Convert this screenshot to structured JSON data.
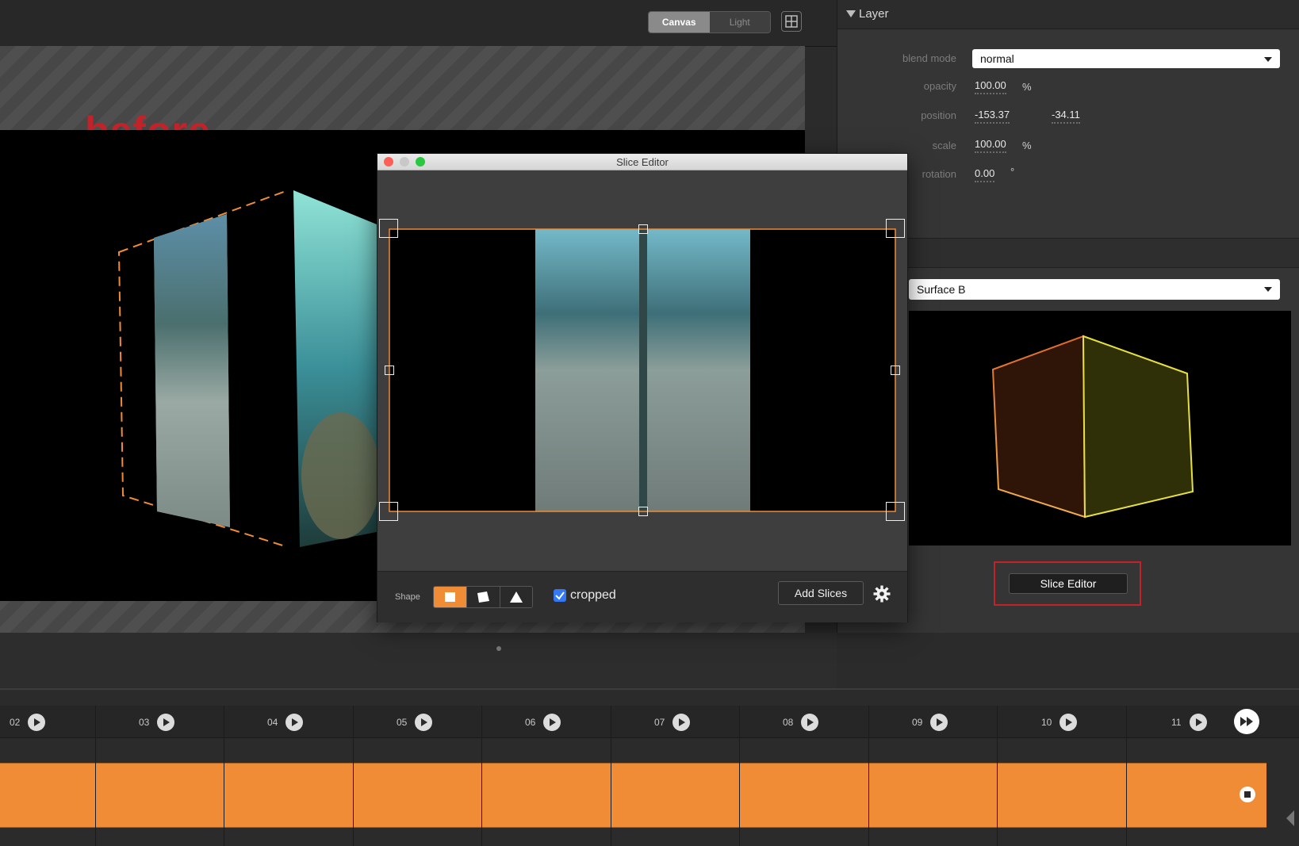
{
  "toolbar": {
    "view_tabs": [
      {
        "label": "Canvas",
        "active": true
      },
      {
        "label": "Light",
        "active": false
      }
    ],
    "grid_icon": "grid-icon"
  },
  "canvas": {
    "overlay_text": "before",
    "overlay_color": "#c22228"
  },
  "slice_editor": {
    "title": "Slice Editor",
    "shape_label": "Shape",
    "shapes": [
      "rectangle-shape-icon",
      "quad-shape-icon",
      "triangle-shape-icon"
    ],
    "selected_shape": "rectangle-shape-icon",
    "cropped_label": "cropped",
    "cropped_checked": true,
    "add_slices_label": "Add Slices",
    "settings_icon": "gear-icon"
  },
  "layer_panel": {
    "title": "Layer",
    "props": {
      "blend_mode_label": "blend mode",
      "blend_mode_value": "normal",
      "opacity_label": "opacity",
      "opacity_value": "100.00",
      "opacity_unit": "%",
      "position_label": "position",
      "position_x": "-153.37",
      "position_y": "-34.11",
      "scale_label": "scale",
      "scale_value": "100.00",
      "scale_unit": "%",
      "rotation_label": "rotation",
      "rotation_value": "0.00",
      "rotation_unit": "°"
    },
    "surface_value": "Surface B",
    "slice_editor_button": "Slice Editor"
  },
  "timeline": {
    "markers": [
      "02",
      "03",
      "04",
      "05",
      "06",
      "07",
      "08",
      "09",
      "10",
      "11"
    ],
    "accent": "#f08c35"
  }
}
